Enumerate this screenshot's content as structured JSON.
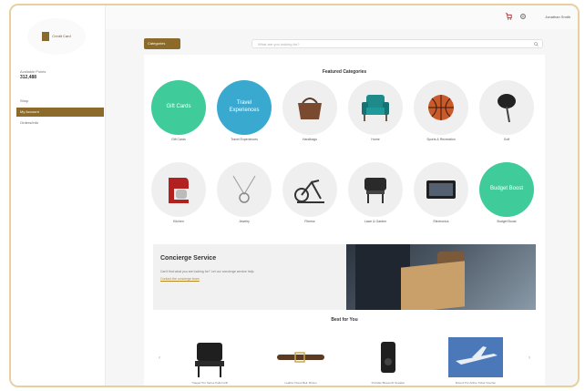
{
  "sidebar": {
    "logo_text": "Credit Card",
    "credit_label": "Available Points",
    "credit_value": "312,488",
    "nav": [
      {
        "label": "Shop"
      },
      {
        "label": "My Account"
      },
      {
        "label": "Orders/Info"
      }
    ]
  },
  "topbar": {
    "username": "Jonathan Smith"
  },
  "search": {
    "category_button": "Categories",
    "placeholder": "What are you looking for?"
  },
  "featured": {
    "title": "Featured Categories",
    "row1": [
      {
        "label": "Gift Cards",
        "text": "Gift Cards",
        "style": "green"
      },
      {
        "label": "Travel Experiences",
        "text": "Travel Experiences",
        "style": "teal"
      },
      {
        "label": "Handbags",
        "text": "",
        "style": "plain"
      },
      {
        "label": "Home",
        "text": "",
        "style": "plain"
      },
      {
        "label": "Sports & Recreation",
        "text": "",
        "style": "plain"
      },
      {
        "label": "Golf",
        "text": "",
        "style": "plain"
      }
    ],
    "row2": [
      {
        "label": "Kitchen",
        "text": "",
        "style": "plain"
      },
      {
        "label": "Jewelry",
        "text": "",
        "style": "plain"
      },
      {
        "label": "Fitness",
        "text": "",
        "style": "plain"
      },
      {
        "label": "Lawn & Garden",
        "text": "",
        "style": "plain"
      },
      {
        "label": "Electronics",
        "text": "",
        "style": "plain"
      },
      {
        "label": "Budget Boost",
        "text": "Budget Boost",
        "style": "green"
      }
    ]
  },
  "concierge": {
    "title": "Concierge Service",
    "description": "Can't find what you are looking for? Let our concierge service help.",
    "link": "Contact the concierge team"
  },
  "best_for_you": {
    "title": "Best for You",
    "products": [
      {
        "label": "Traeger Pro Series Pellet Grill"
      },
      {
        "label": "Leather Dress Belt, Brown"
      },
      {
        "label": "Portable Bluetooth Speaker"
      },
      {
        "label": "Round-Trip Airline Ticket Voucher"
      }
    ]
  },
  "colors": {
    "accent": "#8b6a2a",
    "green": "#3fcb9a",
    "teal": "#3aa9cf"
  }
}
